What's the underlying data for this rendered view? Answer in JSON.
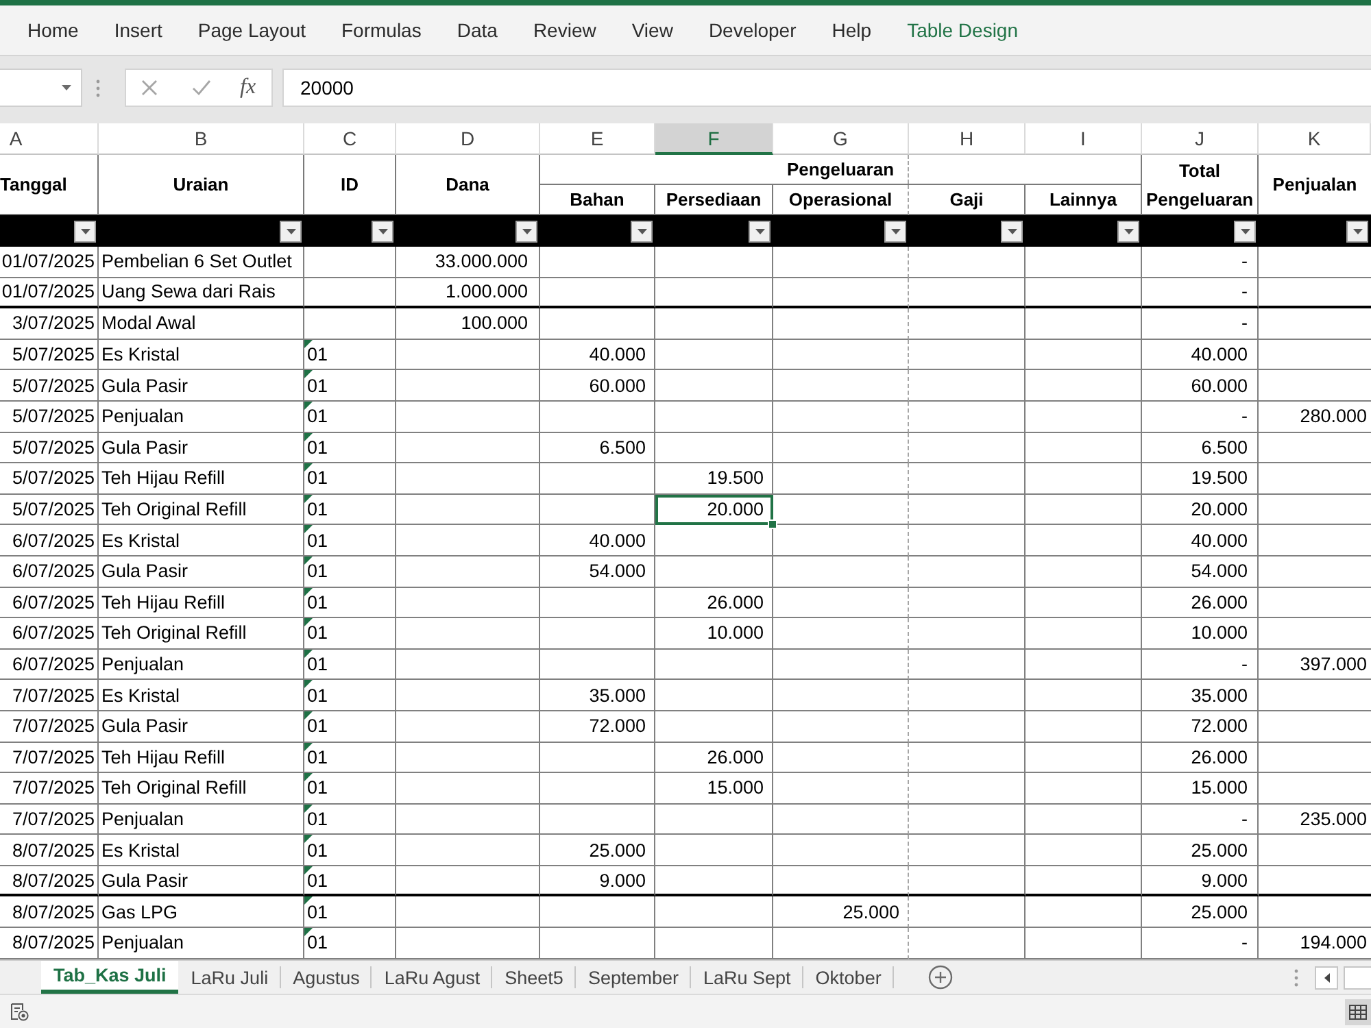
{
  "ribbon": {
    "tabs": [
      {
        "label": "Home",
        "kind": "standard",
        "selected": false
      },
      {
        "label": "Insert",
        "kind": "standard",
        "selected": false
      },
      {
        "label": "Page Layout",
        "kind": "standard",
        "selected": false
      },
      {
        "label": "Formulas",
        "kind": "standard",
        "selected": false
      },
      {
        "label": "Data",
        "kind": "standard",
        "selected": false
      },
      {
        "label": "Review",
        "kind": "standard",
        "selected": false
      },
      {
        "label": "View",
        "kind": "standard",
        "selected": false
      },
      {
        "label": "Developer",
        "kind": "standard",
        "selected": false
      },
      {
        "label": "Help",
        "kind": "standard",
        "selected": false
      },
      {
        "label": "Table Design",
        "kind": "contextual",
        "selected": false
      }
    ]
  },
  "formula_bar": {
    "insert_function": "fx",
    "value": "20000"
  },
  "sheet": {
    "columns": [
      {
        "letter": "A",
        "selected": false
      },
      {
        "letter": "B",
        "selected": false
      },
      {
        "letter": "C",
        "selected": false
      },
      {
        "letter": "D",
        "selected": false
      },
      {
        "letter": "E",
        "selected": false
      },
      {
        "letter": "F",
        "selected": true
      },
      {
        "letter": "G",
        "selected": false
      },
      {
        "letter": "H",
        "selected": false
      },
      {
        "letter": "I",
        "selected": false
      },
      {
        "letter": "J",
        "selected": false
      },
      {
        "letter": "K",
        "selected": false
      }
    ],
    "headers": {
      "date": "Tanggal",
      "description": "Uraian",
      "id": "ID",
      "dana": "Dana",
      "group": "Pengeluaran",
      "bahan": "Bahan",
      "persediaan": "Persediaan",
      "operasional": "Operasional",
      "gaji": "Gaji",
      "lainnya": "Lainnya",
      "total_top": "Total",
      "total_bottom": "Pengeluaran",
      "penjualan": "Penjualan"
    },
    "rows": [
      {
        "date": "01/07/2025",
        "description": "Pembelian 6 Set Outlet",
        "dana": "33.000.000",
        "total": "-",
        "id_flag": false,
        "selected": false,
        "thick_bottom": false
      },
      {
        "date": "01/07/2025",
        "description": "Uang Sewa dari Rais",
        "dana": "1.000.000",
        "total": "-",
        "id_flag": false,
        "selected": false,
        "thick_bottom": true
      },
      {
        "date": "3/07/2025",
        "description": "Modal Awal",
        "dana": "100.000",
        "total": "-",
        "id_flag": false,
        "selected": false,
        "thick_bottom": false
      },
      {
        "date": "5/07/2025",
        "description": "Es Kristal",
        "id": "01",
        "bahan": "40.000",
        "total": "40.000",
        "id_flag": true,
        "selected": false,
        "thick_bottom": false
      },
      {
        "date": "5/07/2025",
        "description": "Gula Pasir",
        "id": "01",
        "bahan": "60.000",
        "total": "60.000",
        "id_flag": true,
        "selected": false,
        "thick_bottom": false
      },
      {
        "date": "5/07/2025",
        "description": "Penjualan",
        "id": "01",
        "total": "-",
        "penjualan": "280.000",
        "id_flag": true,
        "selected": false,
        "thick_bottom": false
      },
      {
        "date": "5/07/2025",
        "description": "Gula Pasir",
        "id": "01",
        "bahan": "6.500",
        "total": "6.500",
        "id_flag": true,
        "selected": false,
        "thick_bottom": false
      },
      {
        "date": "5/07/2025",
        "description": "Teh Hijau Refill",
        "id": "01",
        "persediaan": "19.500",
        "total": "19.500",
        "id_flag": true,
        "selected": false,
        "thick_bottom": false
      },
      {
        "date": "5/07/2025",
        "description": "Teh Original Refill",
        "id": "01",
        "persediaan": "20.000",
        "total": "20.000",
        "id_flag": true,
        "selected": true,
        "thick_bottom": false
      },
      {
        "date": "6/07/2025",
        "description": "Es Kristal",
        "id": "01",
        "bahan": "40.000",
        "total": "40.000",
        "id_flag": true,
        "selected": false,
        "thick_bottom": false
      },
      {
        "date": "6/07/2025",
        "description": "Gula Pasir",
        "id": "01",
        "bahan": "54.000",
        "total": "54.000",
        "id_flag": true,
        "selected": false,
        "thick_bottom": false
      },
      {
        "date": "6/07/2025",
        "description": "Teh Hijau Refill",
        "id": "01",
        "persediaan": "26.000",
        "total": "26.000",
        "id_flag": true,
        "selected": false,
        "thick_bottom": false
      },
      {
        "date": "6/07/2025",
        "description": "Teh Original Refill",
        "id": "01",
        "persediaan": "10.000",
        "total": "10.000",
        "id_flag": true,
        "selected": false,
        "thick_bottom": false
      },
      {
        "date": "6/07/2025",
        "description": "Penjualan",
        "id": "01",
        "total": "-",
        "penjualan": "397.000",
        "id_flag": true,
        "selected": false,
        "thick_bottom": false
      },
      {
        "date": "7/07/2025",
        "description": "Es Kristal",
        "id": "01",
        "bahan": "35.000",
        "total": "35.000",
        "id_flag": true,
        "selected": false,
        "thick_bottom": false
      },
      {
        "date": "7/07/2025",
        "description": "Gula Pasir",
        "id": "01",
        "bahan": "72.000",
        "total": "72.000",
        "id_flag": true,
        "selected": false,
        "thick_bottom": false
      },
      {
        "date": "7/07/2025",
        "description": "Teh Hijau Refill",
        "id": "01",
        "persediaan": "26.000",
        "total": "26.000",
        "id_flag": true,
        "selected": false,
        "thick_bottom": false
      },
      {
        "date": "7/07/2025",
        "description": "Teh Original Refill",
        "id": "01",
        "persediaan": "15.000",
        "total": "15.000",
        "id_flag": true,
        "selected": false,
        "thick_bottom": false
      },
      {
        "date": "7/07/2025",
        "description": "Penjualan",
        "id": "01",
        "total": "-",
        "penjualan": "235.000",
        "id_flag": true,
        "selected": false,
        "thick_bottom": false
      },
      {
        "date": "8/07/2025",
        "description": "Es Kristal",
        "id": "01",
        "bahan": "25.000",
        "total": "25.000",
        "id_flag": true,
        "selected": false,
        "thick_bottom": false
      },
      {
        "date": "8/07/2025",
        "description": "Gula Pasir",
        "id": "01",
        "bahan": "9.000",
        "total": "9.000",
        "id_flag": true,
        "selected": false,
        "thick_bottom": true
      },
      {
        "date": "8/07/2025",
        "description": "Gas LPG",
        "id": "01",
        "operasional": "25.000",
        "total": "25.000",
        "id_flag": true,
        "selected": false,
        "thick_bottom": false
      },
      {
        "date": "8/07/2025",
        "description": "Penjualan",
        "id": "01",
        "total": "-",
        "penjualan": "194.000",
        "id_flag": true,
        "selected": false,
        "thick_bottom": false
      }
    ]
  },
  "sheet_tabs": [
    {
      "label": "Tab_Kas Juli",
      "selected": true
    },
    {
      "label": "LaRu Juli",
      "selected": false
    },
    {
      "label": "Agustus",
      "selected": false
    },
    {
      "label": "LaRu Agust",
      "selected": false
    },
    {
      "label": "Sheet5",
      "selected": false
    },
    {
      "label": "September",
      "selected": false
    },
    {
      "label": "LaRu Sept",
      "selected": false
    },
    {
      "label": "Oktober",
      "selected": false
    }
  ]
}
